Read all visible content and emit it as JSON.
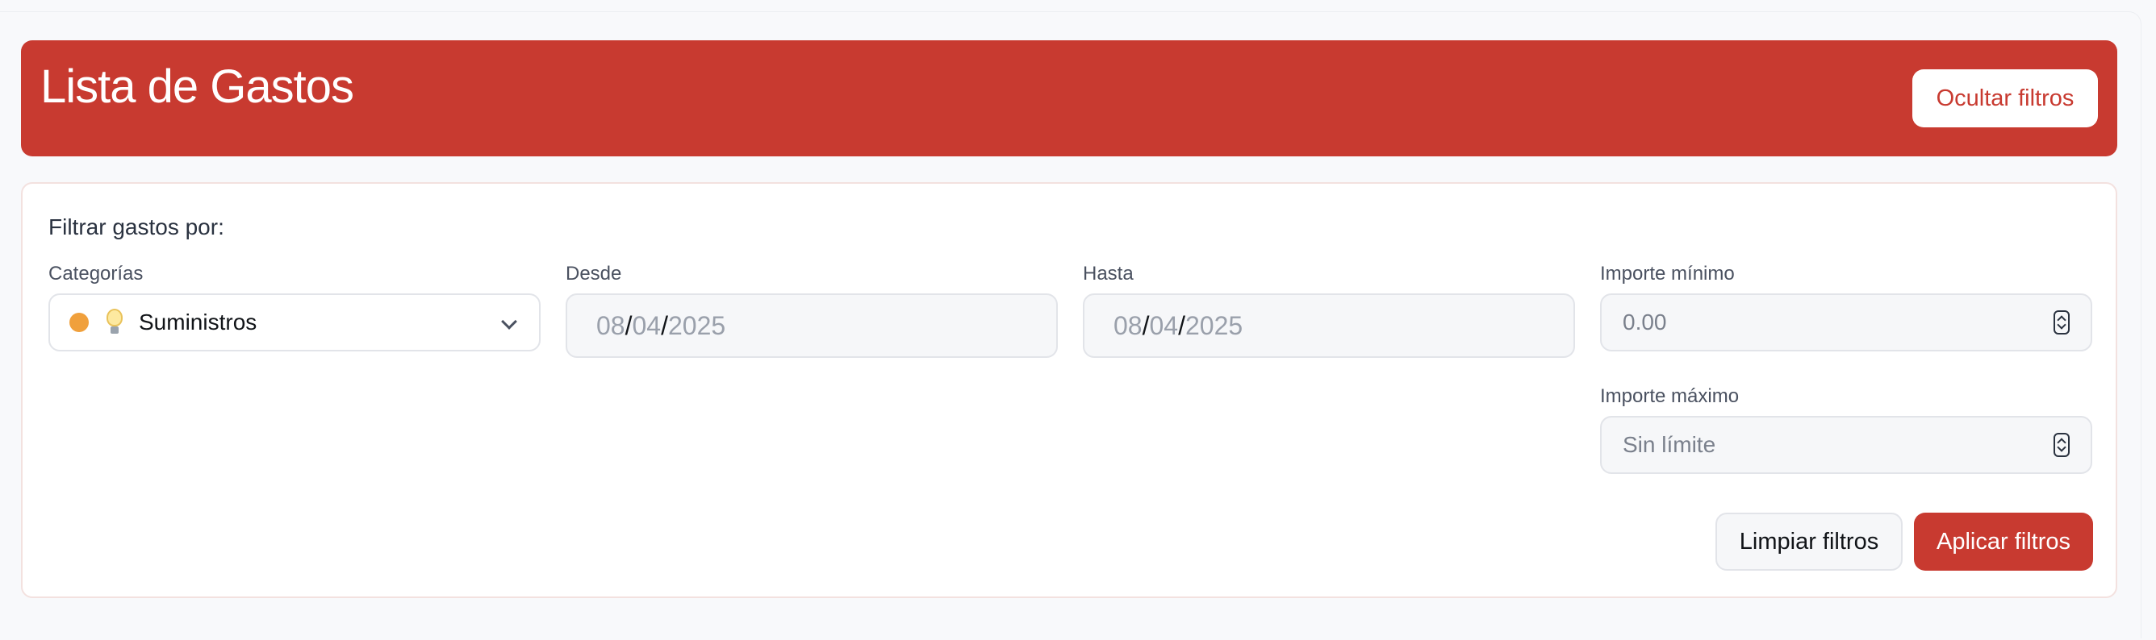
{
  "header": {
    "title": "Lista de Gastos",
    "toggle_filters_label": "Ocultar filtros",
    "background_color": "#c83a30"
  },
  "filters": {
    "heading": "Filtrar gastos por:",
    "category": {
      "label": "Categorías",
      "selected": "Suministros",
      "dot_color": "#f0a03c",
      "icon": "lightbulb-icon"
    },
    "from_date": {
      "label": "Desde",
      "day": "08",
      "month": "04",
      "year": "2025"
    },
    "to_date": {
      "label": "Hasta",
      "day": "08",
      "month": "04",
      "year": "2025"
    },
    "min_amount": {
      "label": "Importe mínimo",
      "placeholder": "0.00"
    },
    "max_amount": {
      "label": "Importe máximo",
      "placeholder": "Sin límite"
    },
    "clear_label": "Limpiar filtros",
    "apply_label": "Aplicar filtros"
  }
}
